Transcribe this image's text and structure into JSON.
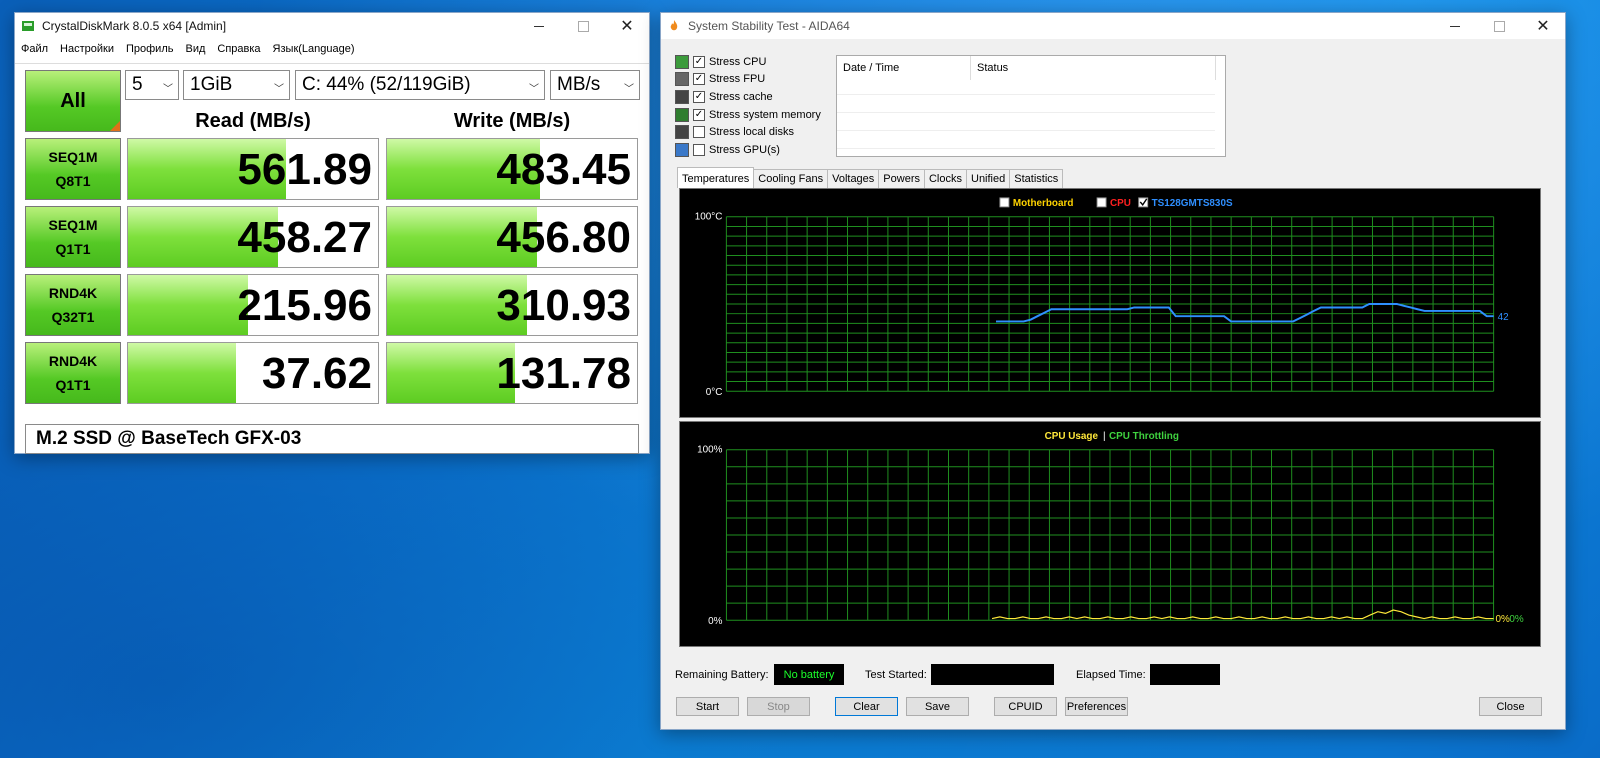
{
  "cdm": {
    "title": "CrystalDiskMark 8.0.5 x64 [Admin]",
    "menu": [
      "Файл",
      "Настройки",
      "Профиль",
      "Вид",
      "Справка",
      "Язык(Language)"
    ],
    "all_label": "All",
    "count": "5",
    "size": "1GiB",
    "drive": "C: 44% (52/119GiB)",
    "unit": "MB/s",
    "read_header": "Read (MB/s)",
    "write_header": "Write (MB/s)",
    "rows": [
      {
        "line1": "SEQ1M",
        "line2": "Q8T1",
        "read": "561.89",
        "write": "483.45",
        "read_fill": 0.63,
        "write_fill": 0.61
      },
      {
        "line1": "SEQ1M",
        "line2": "Q1T1",
        "read": "458.27",
        "write": "456.80",
        "read_fill": 0.6,
        "write_fill": 0.6
      },
      {
        "line1": "RND4K",
        "line2": "Q32T1",
        "read": "215.96",
        "write": "310.93",
        "read_fill": 0.48,
        "write_fill": 0.56
      },
      {
        "line1": "RND4K",
        "line2": "Q1T1",
        "read": "37.62",
        "write": "131.78",
        "read_fill": 0.43,
        "write_fill": 0.51
      }
    ],
    "comment": "M.2 SSD @ BaseTech GFX-03"
  },
  "aida": {
    "title": "System Stability Test - AIDA64",
    "stress": [
      {
        "label": "Stress CPU",
        "checked": true
      },
      {
        "label": "Stress FPU",
        "checked": true
      },
      {
        "label": "Stress cache",
        "checked": true
      },
      {
        "label": "Stress system memory",
        "checked": true
      },
      {
        "label": "Stress local disks",
        "checked": false
      },
      {
        "label": "Stress GPU(s)",
        "checked": false
      }
    ],
    "table_headers": [
      "Date / Time",
      "Status"
    ],
    "tabs": [
      "Temperatures",
      "Cooling Fans",
      "Voltages",
      "Powers",
      "Clocks",
      "Unified",
      "Statistics"
    ],
    "temp_legend": [
      {
        "label": "Motherboard",
        "color": "#ffd400",
        "checked": false
      },
      {
        "label": "CPU",
        "color": "#ff2020",
        "checked": false
      },
      {
        "label": "TS128GMTS830S",
        "color": "#2f8fff",
        "checked": true
      }
    ],
    "temp_top": "100°C",
    "temp_bottom": "0°C",
    "temp_current": "42",
    "usage_legend_a": "CPU Usage",
    "usage_legend_sep": "|",
    "usage_legend_b": "CPU Throttling",
    "usage_top": "100%",
    "usage_bottom": "0%",
    "usage_end_a": "0%",
    "usage_end_b": "0%",
    "remaining_battery_label": "Remaining Battery:",
    "battery_value": "No battery",
    "test_started_label": "Test Started:",
    "elapsed_label": "Elapsed Time:",
    "buttons": {
      "start": "Start",
      "stop": "Stop",
      "clear": "Clear",
      "save": "Save",
      "cpuid": "CPUID",
      "preferences": "Preferences",
      "close": "Close"
    }
  },
  "chart_data": [
    {
      "type": "line",
      "title": "",
      "ylim": [
        0,
        100
      ],
      "series": [
        {
          "name": "TS128GMTS830S",
          "color": "#2f8fff",
          "values": [
            40,
            40,
            40,
            40,
            40,
            41,
            43,
            45,
            47,
            47,
            47,
            47,
            47,
            47,
            47,
            47,
            47,
            47,
            47,
            47,
            48,
            48,
            48,
            48,
            48,
            48,
            43,
            43,
            43,
            43,
            43,
            43,
            43,
            43,
            40,
            40,
            40,
            40,
            40,
            40,
            40,
            40,
            40,
            40,
            42,
            44,
            46,
            48,
            48,
            48,
            48,
            48,
            48,
            48,
            50,
            50,
            50,
            50,
            50,
            49,
            48,
            47,
            46,
            46,
            46,
            46,
            46,
            46,
            46,
            46,
            46,
            43,
            43
          ]
        }
      ]
    },
    {
      "type": "line",
      "title": "",
      "ylim": [
        0,
        100
      ],
      "series": [
        {
          "name": "CPU Usage",
          "color": "#ffe83a",
          "values": [
            1,
            2,
            1,
            1,
            2,
            1,
            1,
            2,
            1,
            1,
            2,
            1,
            2,
            1,
            1,
            2,
            1,
            1,
            2,
            1,
            1,
            2,
            1,
            2,
            1,
            1,
            2,
            1,
            1,
            2,
            1,
            1,
            2,
            1,
            1,
            2,
            1,
            1,
            2,
            1,
            1,
            2,
            1,
            1,
            2,
            1,
            2,
            1,
            1,
            3,
            5,
            4,
            6,
            5,
            3,
            2,
            1,
            2,
            1,
            1,
            2,
            1,
            1,
            2,
            1,
            1
          ]
        }
      ]
    }
  ]
}
